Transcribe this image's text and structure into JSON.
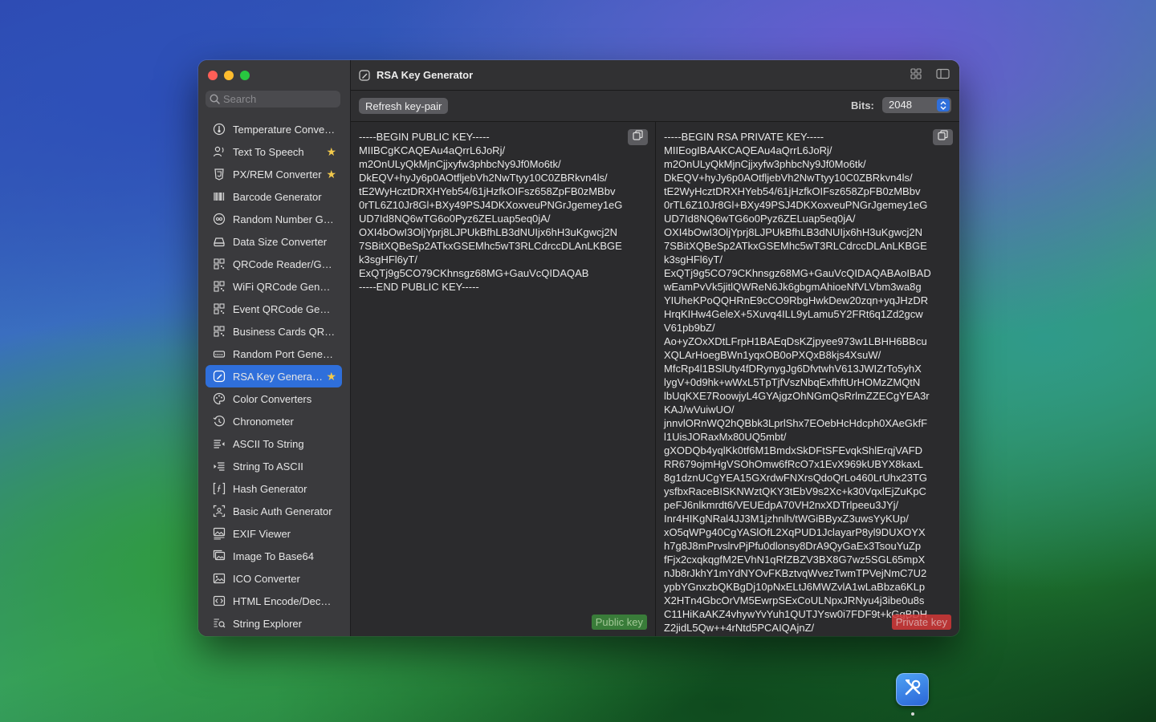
{
  "window": {
    "title": "RSA Key Generator"
  },
  "search": {
    "placeholder": "Search"
  },
  "sidebar": {
    "items": [
      {
        "label": "Temperature Converter",
        "icon": "thermometer-gauge-icon",
        "starred": false,
        "active": false
      },
      {
        "label": "Text To Speech",
        "icon": "speaking-person-icon",
        "starred": true,
        "active": false
      },
      {
        "label": "PX/REM Converter",
        "icon": "css-shield-icon",
        "starred": true,
        "active": false
      },
      {
        "label": "Barcode Generator",
        "icon": "barcode-icon",
        "starred": false,
        "active": false
      },
      {
        "label": "Random Number Generator",
        "icon": "infinity-icon",
        "starred": false,
        "active": false
      },
      {
        "label": "Data Size Converter",
        "icon": "drive-icon",
        "starred": false,
        "active": false
      },
      {
        "label": "QRCode Reader/Generator",
        "icon": "qrcode-icon",
        "starred": false,
        "active": false
      },
      {
        "label": "WiFi QRCode Generator",
        "icon": "qrcode-icon",
        "starred": false,
        "active": false
      },
      {
        "label": "Event QRCode Generator",
        "icon": "qrcode-icon",
        "starred": false,
        "active": false
      },
      {
        "label": "Business Cards QRCode",
        "icon": "qrcode-icon",
        "starred": false,
        "active": false
      },
      {
        "label": "Random Port Generator",
        "icon": "port-icon",
        "starred": false,
        "active": false
      },
      {
        "label": "RSA Key Generator",
        "icon": "signature-icon",
        "starred": true,
        "active": true
      },
      {
        "label": "Color Converters",
        "icon": "palette-icon",
        "starred": false,
        "active": false
      },
      {
        "label": "Chronometer",
        "icon": "clock-history-icon",
        "starred": false,
        "active": false
      },
      {
        "label": "ASCII To String",
        "icon": "text-left-arrow-icon",
        "starred": false,
        "active": false
      },
      {
        "label": "String To ASCII",
        "icon": "text-right-arrow-icon",
        "starred": false,
        "active": false
      },
      {
        "label": "Hash Generator",
        "icon": "function-bracket-icon",
        "starred": false,
        "active": false
      },
      {
        "label": "Basic Auth Generator",
        "icon": "viewfinder-person-icon",
        "starred": false,
        "active": false
      },
      {
        "label": "EXIF Viewer",
        "icon": "photo-text-icon",
        "starred": false,
        "active": false
      },
      {
        "label": "Image To Base64",
        "icon": "photo-stack-icon",
        "starred": false,
        "active": false
      },
      {
        "label": "ICO Converter",
        "icon": "photo-frame-icon",
        "starred": false,
        "active": false
      },
      {
        "label": "HTML Encode/Decode",
        "icon": "code-brackets-icon",
        "starred": false,
        "active": false
      },
      {
        "label": "String Explorer",
        "icon": "magnifier-list-icon",
        "starred": false,
        "active": false
      }
    ]
  },
  "toolbar": {
    "refresh_label": "Refresh key-pair",
    "bits_label": "Bits:",
    "bits_value": "2048"
  },
  "public_pane": {
    "badge": "Public key",
    "key": "-----BEGIN PUBLIC KEY-----\nMIIBCgKCAQEAu4aQrrL6JoRj/\nm2OnULyQkMjnCjjxyfw3phbcNy9Jf0Mo6tk/\nDkEQV+hyJy6p0AOtfljebVh2NwTtyy10C0ZBRkvn4ls/\ntE2WyHcztDRXHYeb54/61jHzfkOIFsz658ZpFB0zMBbv\n0rTL6Z10Jr8Gl+BXy49PSJ4DKXoxveuPNGrJgemey1eG\nUD7Id8NQ6wTG6o0Pyz6ZELuap5eq0jA/\nOXI4bOwI3OljYprj8LJPUkBfhLB3dNUIjx6hH3uKgwcj2N\n7SBitXQBeSp2ATkxGSEMhc5wT3RLCdrccDLAnLKBGE\nk3sgHFl6yT/\nExQTj9g5CO79CKhnsgz68MG+GauVcQIDAQAB\n-----END PUBLIC KEY-----"
  },
  "private_pane": {
    "badge": "Private key",
    "key": "-----BEGIN RSA PRIVATE KEY-----\nMIIEogIBAAKCAQEAu4aQrrL6JoRj/\nm2OnULyQkMjnCjjxyfw3phbcNy9Jf0Mo6tk/\nDkEQV+hyJy6p0AOtfljebVh2NwTtyy10C0ZBRkvn4ls/\ntE2WyHcztDRXHYeb54/61jHzfkOIFsz658ZpFB0zMBbv\n0rTL6Z10Jr8Gl+BXy49PSJ4DKXoxveuPNGrJgemey1eG\nUD7Id8NQ6wTG6o0Pyz6ZELuap5eq0jA/\nOXI4bOwI3OljYprj8LJPUkBfhLB3dNUIjx6hH3uKgwcj2N\n7SBitXQBeSp2ATkxGSEMhc5wT3RLCdrccDLAnLKBGE\nk3sgHFl6yT/\nExQTj9g5CO79CKhnsgz68MG+GauVcQIDAQABAoIBAD\nwEamPvVk5jitlQWReN6Jk6gbgmAhioeNfVLVbm3wa8g\nYIUheKPoQQHRnE9cCO9RbgHwkDew20zqn+yqJHzDR\nHrqKIHw4GeleX+5Xuvq4ILL9yLamu5Y2FRt6q1Zd2gcw\nV61pb9bZ/\nAo+yZOxXDtLFrpH1BAEqDsKZjpyee973w1LBHH6BBcu\nXQLArHoegBWn1yqxOB0oPXQxB8kjs4XsuW/\nMfcRp4l1BSlUty4fDRynygJg6DfvtwhV613JWIZrTo5yhX\nlygV+0d9hk+wWxL5TpTjfVszNbqExfhftUrHOMzZMQtN\nlbUqKXE7RoowjyL4GYAjgzOhNGmQsRrlmZZECgYEA3r\nKAJ/wVuiwUO/\njnnvlORnWQ2hQBbk3LprlShx7EOebHcHdcph0XAeGkfF\nl1UisJORaxMx80UQ5mbt/\ngXODQb4yqlKk0tf6M1BmdxSkDFtSFEvqkShlErqjVAFD\nRR679ojmHgVSOhOmw6fRcO7x1EvX969kUBYX8kaxL\n8g1dznUCgYEA15GXrdwFNXrsQdoQrLo460LrUhx23TG\nysfbxRaceBISKNWztQKY3tEbV9s2Xc+k30VqxlEjZuKpC\npeFJ6nlkmrdt6/VEUEdpA70VH2nxXDTrlpeeu3JYj/\nInr4HIKgNRal4JJ3M1jzhnlh/tWGiBByxZ3uwsYyKUp/\nxO5qWPg40CgYASlOfL2XqPUD1JclayarP8yl9DUXOYX\nh7g8J8mPrvslrvPjPfu0dlonsy8DrA9QyGaEx3TsouYuZp\nfFjx2cxqkqgfM2EVhN1qRfZBZV3BX8G7wz5SGL65mpX\nnJb8rJkhY1mYdNYOvFKBztvqWvezTwmTPVejNmC7U2\nypbYGnxzbQKBgDj10pNxELtJ6MWZvlA1wLaBbza6KLp\nX2HTn4GbcOrVM5EwrpSExCoULNpxJRNyu4j3ibe0u8s\nC11HiKaAKZ4vhywYvYuh1QUTJYsw0i7FDF9t+kGgBDH\nZ2jidL5Qw++4rNtd5PCAIQAjnZ/"
  },
  "colors": {
    "accent": "#2f6fdb",
    "star": "#f2c94c",
    "public_badge": "#3c8b3c",
    "private_badge": "#d33838"
  }
}
